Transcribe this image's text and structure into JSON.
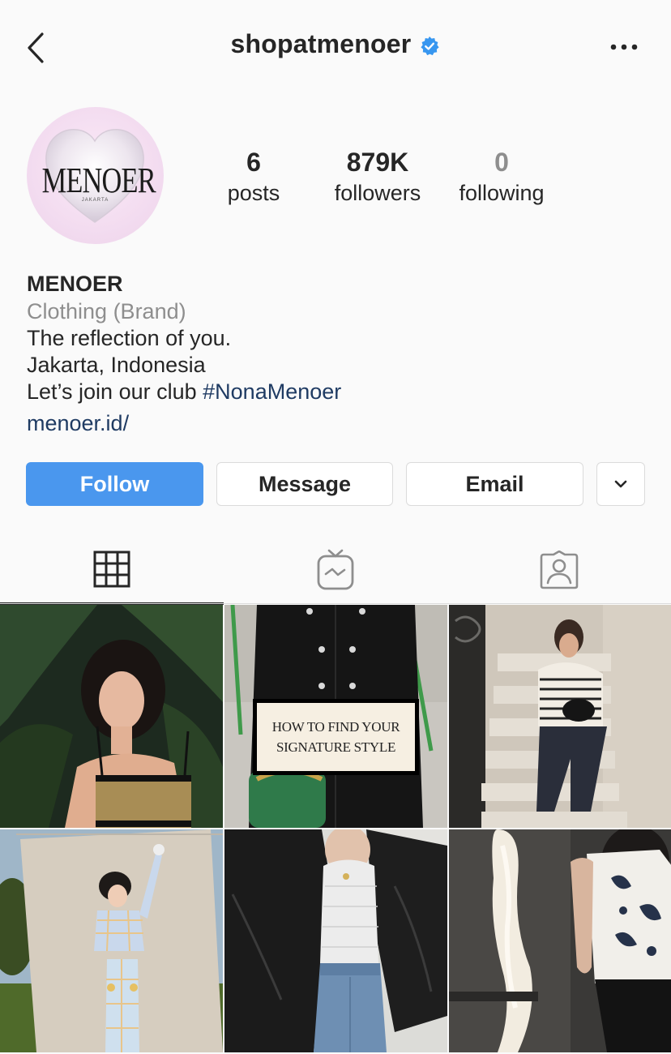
{
  "header": {
    "username": "shopatmenoer",
    "verified": true,
    "back_icon": "chevron-left-icon",
    "more_icon": "more-horizontal-icon"
  },
  "avatar": {
    "logo_text": "MENOER",
    "logo_subtext": "JAKARTA"
  },
  "stats": {
    "posts": {
      "value": "6",
      "label": "posts"
    },
    "followers": {
      "value": "879K",
      "label": "followers"
    },
    "following": {
      "value": "0",
      "label": "following"
    }
  },
  "bio": {
    "name": "MENOER",
    "category": "Clothing (Brand)",
    "line1": "The reflection of you.",
    "line2": "Jakarta, Indonesia",
    "line3_prefix": "Let’s join our club ",
    "line3_hashtag": "#NonaMenoer",
    "link": "menoer.id/"
  },
  "actions": {
    "follow": "Follow",
    "message": "Message",
    "email": "Email"
  },
  "tabs": [
    {
      "name": "grid",
      "icon": "grid-icon",
      "active": true
    },
    {
      "name": "igtv",
      "icon": "igtv-icon",
      "active": false
    },
    {
      "name": "tagged",
      "icon": "tagged-icon",
      "active": false
    }
  ],
  "posts": {
    "post2_line1": "HOW TO FIND YOUR",
    "post2_line2": "SIGNATURE STYLE"
  },
  "colors": {
    "follow_blue": "#4a97ee",
    "verified_blue": "#3897f0",
    "link_navy": "#1f3b63",
    "muted_gray": "#8e8e8e"
  }
}
